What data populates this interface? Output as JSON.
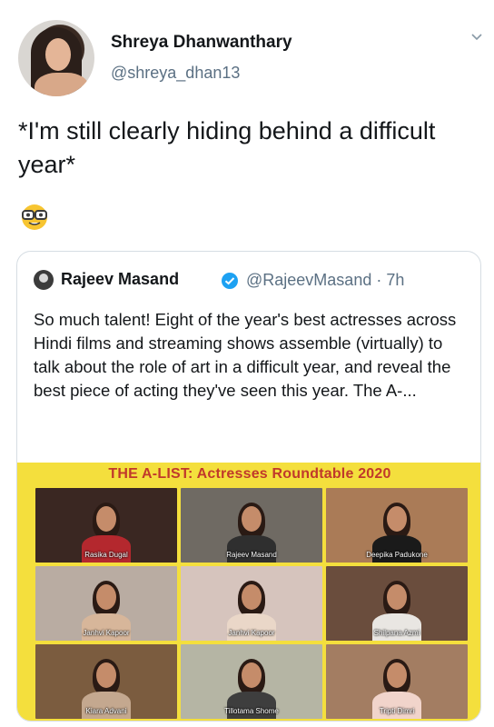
{
  "tweet": {
    "author_name": "Shreya Dhanwanthary",
    "author_handle": "@shreya_dhan13",
    "text": "*I'm still clearly hiding behind a difficult year*",
    "emoji": "nerd-face-emoji"
  },
  "quoted": {
    "author_name": "Rajeev Masand",
    "author_handle": "@RajeevMasand",
    "time": "· 7h",
    "text": "So much talent! Eight of the year's best actresses across Hindi films and streaming shows assemble (virtually) to talk about the role of art in a difficult year, and reveal the best piece of acting they've seen this year. The A-...",
    "media_title": "THE A-LIST: Actresses Roundtable 2020",
    "tiles": [
      {
        "label": "Rasika Dugal",
        "bg": "#3a2722",
        "wear": "#b4282e"
      },
      {
        "label": "Rajeev Masand",
        "bg": "#6f6a63",
        "wear": "#2f2f2f"
      },
      {
        "label": "Deepika Padukone",
        "bg": "#aa7b57",
        "wear": "#1a1a1a"
      },
      {
        "label": "Janhvi Kapoor",
        "bg": "#b9aca2",
        "wear": "#d7b69a"
      },
      {
        "label": "Janhvi Kapoor",
        "bg": "#d6c4bd",
        "wear": "#ead7c8"
      },
      {
        "label": "Shilpana Azmi",
        "bg": "#6a4d3d",
        "wear": "#e9e6e2"
      },
      {
        "label": "Kiara Advani",
        "bg": "#7b5c3f",
        "wear": "#c4a88f"
      },
      {
        "label": "Tillotama Shome",
        "bg": "#b5b5a4",
        "wear": "#3e3e3e"
      },
      {
        "label": "Tripti Dimri",
        "bg": "#a37d62",
        "wear": "#f1d4cb"
      }
    ]
  },
  "colors": {
    "accent_blue": "#1da1f2",
    "media_banner": "#f4df3d",
    "media_title": "#c0392b"
  }
}
